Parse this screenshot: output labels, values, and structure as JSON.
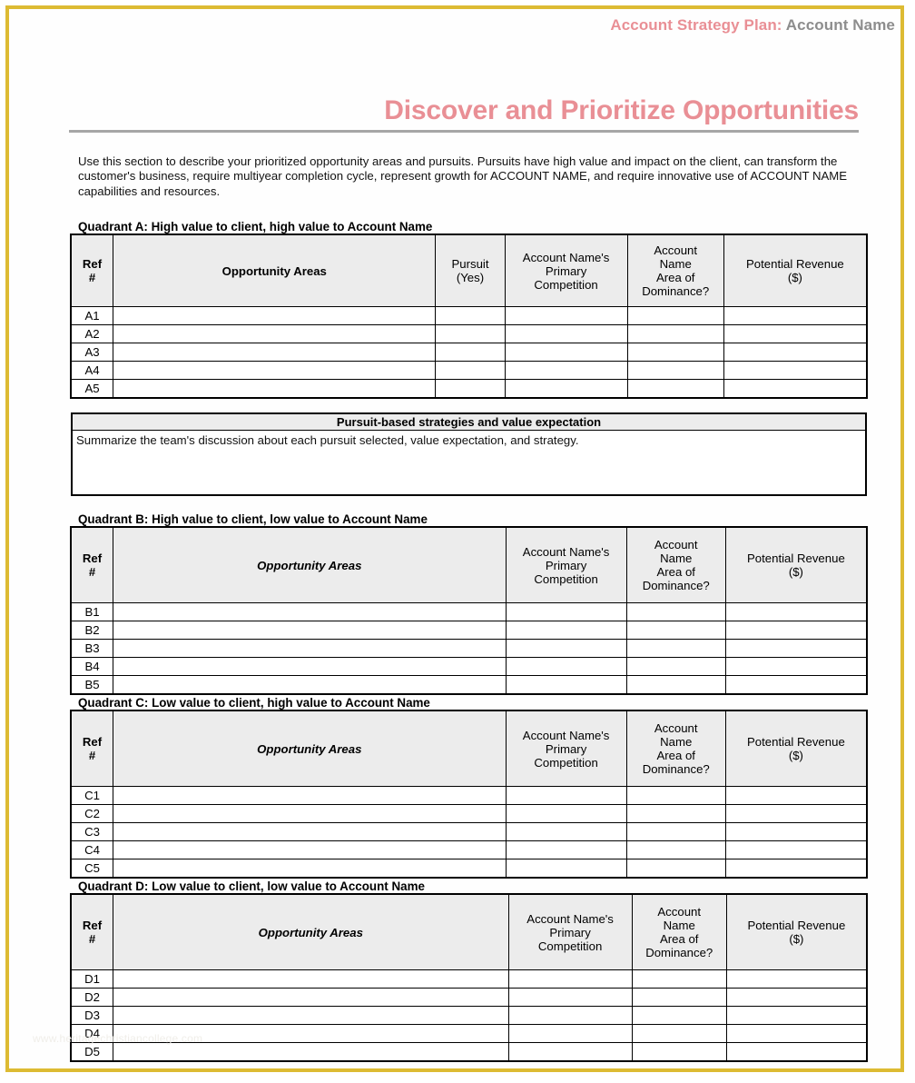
{
  "header": {
    "label": "Account Strategy Plan:",
    "account": "Account Name"
  },
  "title": "Discover and Prioritize Opportunities",
  "intro": "Use this section to describe your prioritized opportunity areas and pursuits.  Pursuits have high value and impact on the client, can transform the customer's business, require multiyear completion cycle, represent growth for ACCOUNT NAME, and require innovative use of ACCOUNT NAME capabilities and resources.",
  "columns": {
    "ref": "Ref\n#",
    "ref_line1": "Ref",
    "ref_line2": "#",
    "opportunity": "Opportunity Areas",
    "pursuit_line1": "Pursuit",
    "pursuit_line2": "(Yes)",
    "competition_line1": "Account Name's",
    "competition_line2": "Primary",
    "competition_line3": "Competition",
    "dominance_line1": "Account",
    "dominance_line2": "Name",
    "dominance_line3": "Area of",
    "dominance_line4": "Dominance?",
    "revenue_line1": "Potential Revenue",
    "revenue_line2": "($)"
  },
  "quadrants": [
    {
      "id": "a",
      "label": "Quadrant A: High value to client, high value to Account Name",
      "rows": [
        "A1",
        "A2",
        "A3",
        "A4",
        "A5"
      ]
    },
    {
      "id": "b",
      "label": "Quadrant B: High value to client, low value to Account Name",
      "rows": [
        "B1",
        "B2",
        "B3",
        "B4",
        "B5"
      ]
    },
    {
      "id": "c",
      "label": "Quadrant C: Low value to client, high value to Account Name",
      "rows": [
        "C1",
        "C2",
        "C3",
        "C4",
        "C5"
      ]
    },
    {
      "id": "d",
      "label": "Quadrant D: Low value to client, low value to Account Name",
      "rows": [
        "D1",
        "D2",
        "D3",
        "D4",
        "D5"
      ]
    }
  ],
  "pursuit_box": {
    "title": "Pursuit-based strategies and value expectation",
    "body": "Summarize the team's discussion about each pursuit selected, value expectation, and strategy."
  },
  "watermark": "www.heritagechristiancollege.com",
  "colors": {
    "accent_pink": "#e98f95",
    "header_gray": "#8d8d8d",
    "frame_gold": "#ddbb33",
    "table_header_fill": "#ececec"
  }
}
